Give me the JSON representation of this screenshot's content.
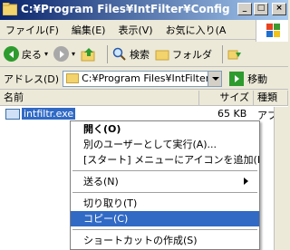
{
  "window": {
    "title": "C:¥Program Files¥IntFilter¥Config",
    "buttons": {
      "minimize": "_",
      "maximize": "□",
      "close": "×"
    }
  },
  "menubar": {
    "items": [
      "ファイル(F)",
      "編集(E)",
      "表示(V)",
      "お気に入り(A"
    ]
  },
  "toolbar": {
    "back_label": "戻る",
    "search_label": "検索",
    "folders_label": "フォルダ",
    "icons": [
      "back-icon",
      "forward-icon",
      "up-folder-icon",
      "search-icon",
      "folders-icon",
      "folder-options-icon"
    ]
  },
  "address": {
    "label": "アドレス(D)",
    "value": "C:¥Program Files¥IntFilter¥C",
    "go_label": "移動"
  },
  "list": {
    "columns": [
      "名前",
      "サイズ",
      "種類"
    ],
    "rows": [
      {
        "name": "intfiltr.exe",
        "size": "65 KB",
        "type": "アプリ"
      }
    ]
  },
  "context_menu": {
    "items": [
      {
        "label": "開く(O)",
        "bold": true
      },
      {
        "label": "別のユーザーとして実行(A)..."
      },
      {
        "label": "[スタート] メニューにアイコンを追加(I)"
      },
      {
        "separator": true
      },
      {
        "label": "送る(N)",
        "submenu": true
      },
      {
        "separator": true
      },
      {
        "label": "切り取り(T)"
      },
      {
        "label": "コピー(C)",
        "selected": true
      },
      {
        "separator": true
      },
      {
        "label": "ショートカットの作成(S)"
      }
    ]
  },
  "colors": {
    "selection": "#316ac5",
    "title_start": "#0a246a",
    "title_end": "#a6caf0"
  }
}
